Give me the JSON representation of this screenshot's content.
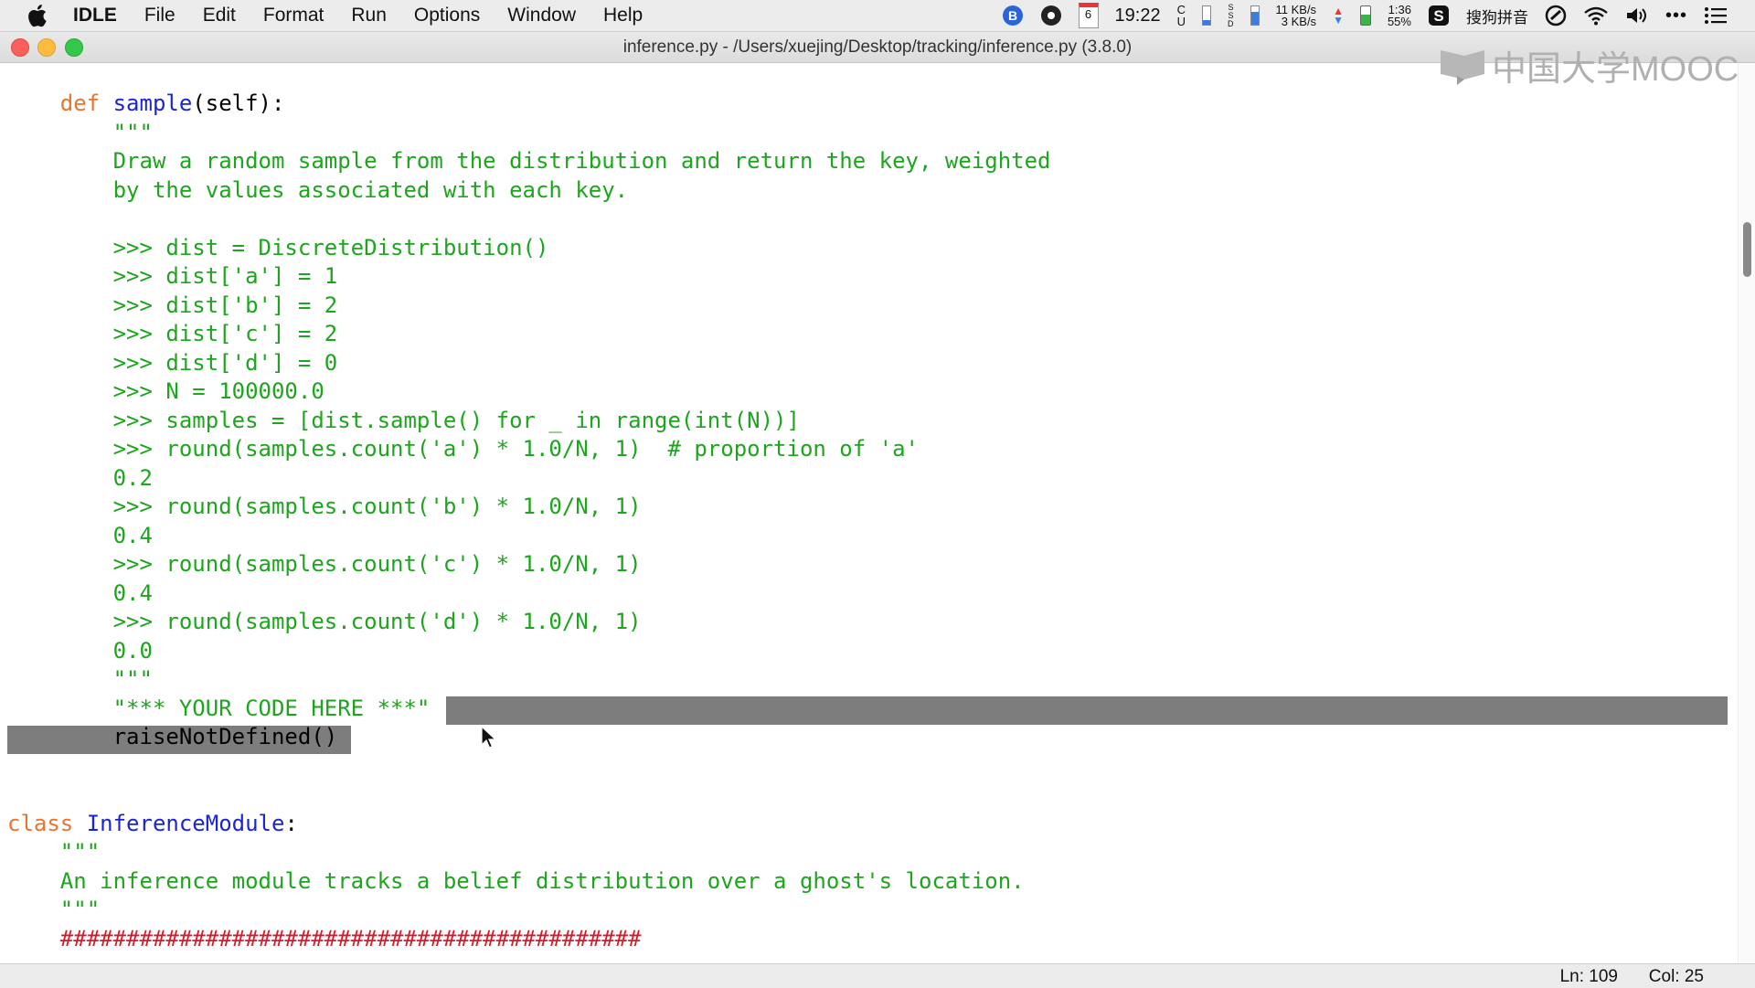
{
  "menubar": {
    "app": "IDLE",
    "items": [
      "File",
      "Edit",
      "Format",
      "Run",
      "Options",
      "Window",
      "Help"
    ],
    "clock": "19:22",
    "calendar_day": "6",
    "net_up": "11 KB/s",
    "net_down": "3 KB/s",
    "battery_time": "1:36",
    "battery_pct": "55%",
    "cpu_label": "C\nU",
    "ssd_label": "S\nS\nD",
    "input_method": "搜狗拼音"
  },
  "window": {
    "title": "inference.py - /Users/xuejing/Desktop/tracking/inference.py (3.8.0)"
  },
  "watermark": {
    "text": "中国大学MOOC"
  },
  "code": {
    "def_keyword": "def",
    "def_name": "sample",
    "def_rest": "(self):",
    "doc_open": "\"\"\"",
    "doc_lines": [
      "Draw a random sample from the distribution and return the key, weighted",
      "by the values associated with each key.",
      "",
      ">>> dist = DiscreteDistribution()",
      ">>> dist['a'] = 1",
      ">>> dist['b'] = 2",
      ">>> dist['c'] = 2",
      ">>> dist['d'] = 0",
      ">>> N = 100000.0",
      ">>> samples = [dist.sample() for _ in range(int(N))]",
      ">>> round(samples.count('a') * 1.0/N, 1)  # proportion of 'a'",
      "0.2",
      ">>> round(samples.count('b') * 1.0/N, 1)",
      "0.4",
      ">>> round(samples.count('c') * 1.0/N, 1)",
      "0.4",
      ">>> round(samples.count('d') * 1.0/N, 1)",
      "0.0"
    ],
    "doc_close": "\"\"\"",
    "your_code": "\"*** YOUR CODE HERE ***\"",
    "raise_line": "raiseNotDefined()",
    "class_keyword": "class",
    "class_name": "InferenceModule",
    "class_rest": ":",
    "class_doc_open": "\"\"\"",
    "class_doc_line": "An inference module tracks a belief distribution over a ghost's location.",
    "class_doc_close": "\"\"\"",
    "hash_line": "############################################"
  },
  "statusbar": {
    "ln": "Ln: 109",
    "col": "Col: 25"
  },
  "colors": {
    "keyword": "#e4762f",
    "definition": "#1b25d6",
    "string": "#1ea51e",
    "comment": "#d11c2c",
    "selection": "#7d7d7d"
  }
}
